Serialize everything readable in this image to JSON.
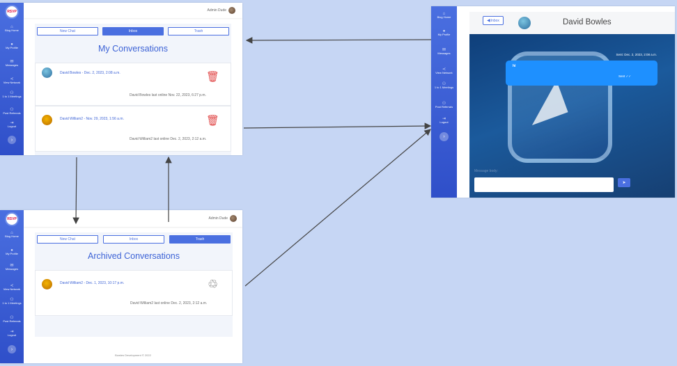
{
  "nav": {
    "logo_text": "RSVP",
    "items": [
      {
        "label": "Blog Home",
        "icon": "home-icon"
      },
      {
        "label": "My Profile",
        "icon": "user-icon"
      },
      {
        "label": "Messages",
        "icon": "envelope-icon"
      },
      {
        "label": "View Network",
        "icon": "share-icon"
      },
      {
        "label": "1 to 1 Meetings",
        "icon": "people-icon"
      },
      {
        "label": "Post Referrals",
        "icon": "referral-icon"
      },
      {
        "label": "Logout",
        "icon": "logout-icon"
      }
    ],
    "toggle_symbol": "›"
  },
  "admin": {
    "name": "Admin Dude"
  },
  "tabs": {
    "new_chat": "New Chat",
    "inbox": "Inbox",
    "trash": "Trash"
  },
  "inbox_screen": {
    "heading": "My Conversations",
    "conversations": [
      {
        "title": "David Bowles - Dec. 2, 2023, 2:08 a.m.",
        "last_online": "David Bowles last online Nov. 22, 2023, 6:27 p.m."
      },
      {
        "title": "David William2 - Nov. 29, 2023, 1:56 a.m.",
        "last_online": "David William2 last online Dec. 2, 2023, 2:12 a.m."
      }
    ]
  },
  "trash_screen": {
    "heading": "Archived Conversations",
    "conversations": [
      {
        "title": "David William2 - Dec. 1, 2023, 10:17 p.m.",
        "last_online": "David William2 last online Dec. 2, 2023, 2:12 a.m."
      }
    ],
    "footer": "Bowles Development © 2022"
  },
  "chat_screen": {
    "back_label": "Inbox",
    "back_symbol": "◀",
    "contact_name": "David Bowles",
    "message": {
      "sent_time": "Sent: Dec. 2, 2023, 2:08 a.m.",
      "text": "hi",
      "status": "Sent ✓✓"
    },
    "input_label": "Message body:",
    "input_value": "",
    "send_symbol": "➤"
  },
  "colors": {
    "primary": "#4a6fe0",
    "background": "#c6d6f4",
    "trash_icon": "#e04646",
    "chat_bubble": "#1e90ff"
  }
}
